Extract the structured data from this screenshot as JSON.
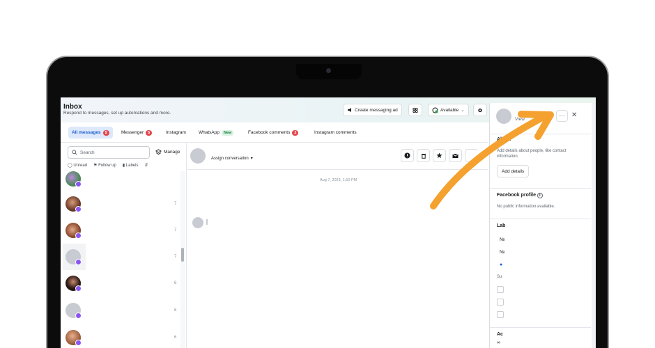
{
  "header": {
    "title": "Inbox",
    "subtitle": "Respond to messages, set up automations and more.",
    "create_ad": "Create messaging ad",
    "availability": "Available"
  },
  "tabs": [
    {
      "label": "All messages",
      "count": "5"
    },
    {
      "label": "Messenger",
      "count": "5"
    },
    {
      "label": "Instagram"
    },
    {
      "label": "WhatsApp",
      "badge": "New"
    },
    {
      "label": "Facebook comments",
      "count": "2"
    },
    {
      "label": "Instagram comments"
    }
  ],
  "left": {
    "search_placeholder": "Search",
    "manage": "Manage",
    "filters": [
      "Unread",
      "Follow up",
      "Labels"
    ],
    "rows": [
      {
        "time": ""
      },
      {
        "time": "7"
      },
      {
        "time": "7"
      },
      {
        "time": "7"
      },
      {
        "time": "6"
      },
      {
        "time": "6"
      },
      {
        "time": "6"
      }
    ]
  },
  "conversation": {
    "assign": "Assign conversation",
    "date": "Aug 7, 2023, 1:50 PM"
  },
  "right": {
    "view": "View",
    "about_title": "About",
    "about_text": "Add details about people, like contact information.",
    "add_details": "Add details",
    "fb_profile_title": "Facebook profile",
    "fb_profile_text": "No public information available.",
    "labels_title": "Lab",
    "sug_text": "Su",
    "activity_title": "Ac"
  },
  "colors": {
    "accent": "#1d5fd0",
    "badge": "#e4474d",
    "messenger": "#8a55f0",
    "arrow": "#f4a12f"
  }
}
